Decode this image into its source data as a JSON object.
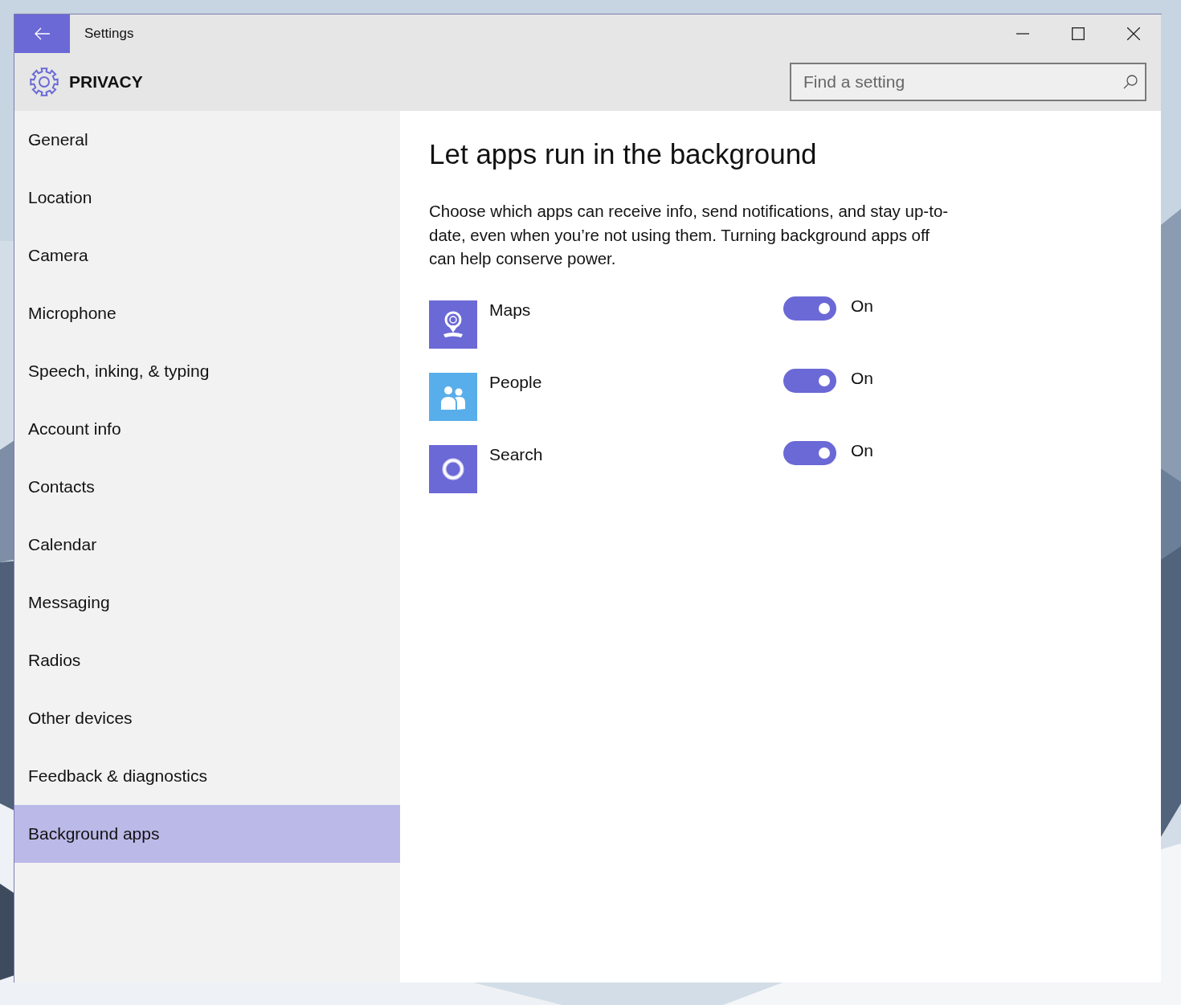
{
  "window": {
    "title": "Settings"
  },
  "header": {
    "title": "PRIVACY",
    "search": {
      "placeholder": "Find a setting"
    }
  },
  "sidebar": {
    "items": [
      {
        "label": "General",
        "selected": false
      },
      {
        "label": "Location",
        "selected": false
      },
      {
        "label": "Camera",
        "selected": false
      },
      {
        "label": "Microphone",
        "selected": false
      },
      {
        "label": "Speech, inking, & typing",
        "selected": false
      },
      {
        "label": "Account info",
        "selected": false
      },
      {
        "label": "Contacts",
        "selected": false
      },
      {
        "label": "Calendar",
        "selected": false
      },
      {
        "label": "Messaging",
        "selected": false
      },
      {
        "label": "Radios",
        "selected": false
      },
      {
        "label": "Other devices",
        "selected": false
      },
      {
        "label": "Feedback & diagnostics",
        "selected": false
      },
      {
        "label": "Background apps",
        "selected": true
      }
    ]
  },
  "content": {
    "title": "Let apps run in the background",
    "description": "Choose which apps can receive info, send notifications, and stay up-to-date, even when you’re not using them. Turning background apps off can help conserve power.",
    "apps": [
      {
        "name": "Maps",
        "kind": "maps",
        "color": "#6b69d6",
        "on": true,
        "state_label": "On"
      },
      {
        "name": "People",
        "kind": "people",
        "color": "#58aeea",
        "on": true,
        "state_label": "On"
      },
      {
        "name": "Search",
        "kind": "search",
        "color": "#6b69d6",
        "on": true,
        "state_label": "On"
      }
    ]
  }
}
